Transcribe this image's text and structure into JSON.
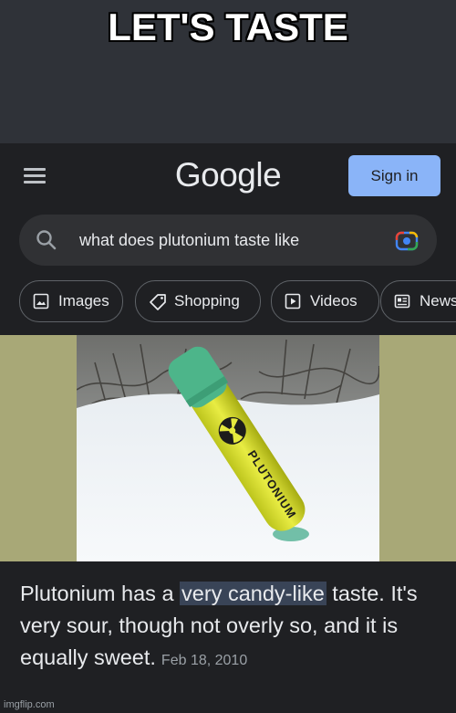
{
  "meme": {
    "caption": "LET'S TASTE",
    "watermark": "imgflip.com"
  },
  "header": {
    "menu_icon": "hamburger-menu-icon",
    "logo": "Google",
    "signin_label": "Sign in",
    "signin_color": "#8ab4f8"
  },
  "search": {
    "query": "what does plutonium taste like",
    "search_icon": "magnifier-icon",
    "lens_icon": "google-lens-camera-icon"
  },
  "filters": [
    {
      "label": "Images",
      "icon": "image-icon"
    },
    {
      "label": "Shopping",
      "icon": "tag-icon"
    },
    {
      "label": "Videos",
      "icon": "play-icon"
    },
    {
      "label": "News",
      "icon": "newspaper-icon"
    }
  ],
  "image": {
    "vial_label": "PLUTONIUM"
  },
  "answer": {
    "pre": "Plutonium has a ",
    "highlight": "very candy-like",
    "post": " taste. It's very sour, though not overly so, and it is equally sweet.",
    "date": "Feb 18, 2010",
    "highlight_color": "#394457"
  },
  "colors": {
    "background": "#1f2023",
    "meme_background": "#2f3238",
    "image_band": "#a8a877"
  }
}
